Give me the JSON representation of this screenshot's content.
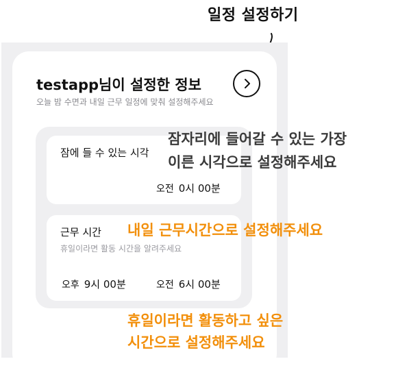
{
  "annotations": {
    "top": "일정 설정하기",
    "sleep_line1": "잠자리에 들어갈 수 있는 가장",
    "sleep_line2": "이른 시각으로 설정해주세요",
    "work": "내일 근무시간으로 설정해주세요",
    "holiday_line1": "휴일이라면 활동하고 싶은",
    "holiday_line2": "시간으로 설정해주세요"
  },
  "card": {
    "title": "testapp님이 설정한 정보",
    "subtitle": "오늘 밤 수면과 내일 근무 일정에 맞춰 설정해주세요"
  },
  "sleep": {
    "title": "잠에 들 수 있는 시각",
    "time_ampm": "오전",
    "time_value": "0시 00분"
  },
  "work": {
    "title": "근무 시간",
    "subtitle": "휴일이라면 활동 시간을 알려주세요",
    "start_ampm": "오후",
    "start_value": "9시 00분",
    "end_ampm": "오전",
    "end_value": "6시 00분"
  },
  "colors": {
    "annotation_orange": "#f28f0b",
    "panel_bg": "#efeff1"
  },
  "icons": {
    "next": "chevron-right-icon"
  }
}
